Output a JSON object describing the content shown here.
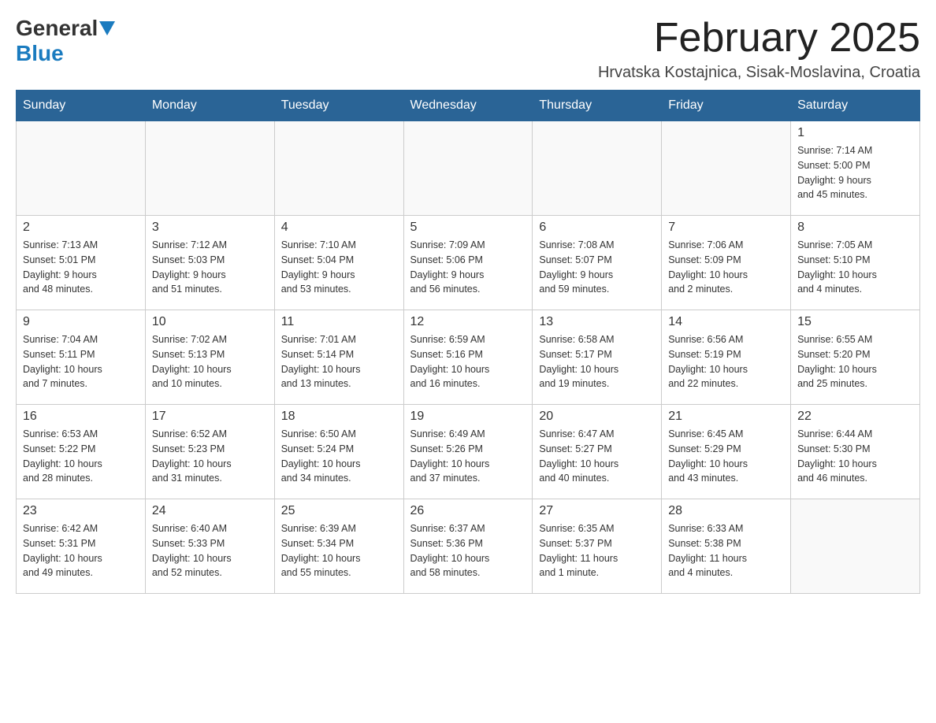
{
  "logo": {
    "general": "General",
    "blue": "Blue"
  },
  "title": "February 2025",
  "subtitle": "Hrvatska Kostajnica, Sisak-Moslavina, Croatia",
  "weekdays": [
    "Sunday",
    "Monday",
    "Tuesday",
    "Wednesday",
    "Thursday",
    "Friday",
    "Saturday"
  ],
  "weeks": [
    [
      {
        "day": "",
        "info": ""
      },
      {
        "day": "",
        "info": ""
      },
      {
        "day": "",
        "info": ""
      },
      {
        "day": "",
        "info": ""
      },
      {
        "day": "",
        "info": ""
      },
      {
        "day": "",
        "info": ""
      },
      {
        "day": "1",
        "info": "Sunrise: 7:14 AM\nSunset: 5:00 PM\nDaylight: 9 hours\nand 45 minutes."
      }
    ],
    [
      {
        "day": "2",
        "info": "Sunrise: 7:13 AM\nSunset: 5:01 PM\nDaylight: 9 hours\nand 48 minutes."
      },
      {
        "day": "3",
        "info": "Sunrise: 7:12 AM\nSunset: 5:03 PM\nDaylight: 9 hours\nand 51 minutes."
      },
      {
        "day": "4",
        "info": "Sunrise: 7:10 AM\nSunset: 5:04 PM\nDaylight: 9 hours\nand 53 minutes."
      },
      {
        "day": "5",
        "info": "Sunrise: 7:09 AM\nSunset: 5:06 PM\nDaylight: 9 hours\nand 56 minutes."
      },
      {
        "day": "6",
        "info": "Sunrise: 7:08 AM\nSunset: 5:07 PM\nDaylight: 9 hours\nand 59 minutes."
      },
      {
        "day": "7",
        "info": "Sunrise: 7:06 AM\nSunset: 5:09 PM\nDaylight: 10 hours\nand 2 minutes."
      },
      {
        "day": "8",
        "info": "Sunrise: 7:05 AM\nSunset: 5:10 PM\nDaylight: 10 hours\nand 4 minutes."
      }
    ],
    [
      {
        "day": "9",
        "info": "Sunrise: 7:04 AM\nSunset: 5:11 PM\nDaylight: 10 hours\nand 7 minutes."
      },
      {
        "day": "10",
        "info": "Sunrise: 7:02 AM\nSunset: 5:13 PM\nDaylight: 10 hours\nand 10 minutes."
      },
      {
        "day": "11",
        "info": "Sunrise: 7:01 AM\nSunset: 5:14 PM\nDaylight: 10 hours\nand 13 minutes."
      },
      {
        "day": "12",
        "info": "Sunrise: 6:59 AM\nSunset: 5:16 PM\nDaylight: 10 hours\nand 16 minutes."
      },
      {
        "day": "13",
        "info": "Sunrise: 6:58 AM\nSunset: 5:17 PM\nDaylight: 10 hours\nand 19 minutes."
      },
      {
        "day": "14",
        "info": "Sunrise: 6:56 AM\nSunset: 5:19 PM\nDaylight: 10 hours\nand 22 minutes."
      },
      {
        "day": "15",
        "info": "Sunrise: 6:55 AM\nSunset: 5:20 PM\nDaylight: 10 hours\nand 25 minutes."
      }
    ],
    [
      {
        "day": "16",
        "info": "Sunrise: 6:53 AM\nSunset: 5:22 PM\nDaylight: 10 hours\nand 28 minutes."
      },
      {
        "day": "17",
        "info": "Sunrise: 6:52 AM\nSunset: 5:23 PM\nDaylight: 10 hours\nand 31 minutes."
      },
      {
        "day": "18",
        "info": "Sunrise: 6:50 AM\nSunset: 5:24 PM\nDaylight: 10 hours\nand 34 minutes."
      },
      {
        "day": "19",
        "info": "Sunrise: 6:49 AM\nSunset: 5:26 PM\nDaylight: 10 hours\nand 37 minutes."
      },
      {
        "day": "20",
        "info": "Sunrise: 6:47 AM\nSunset: 5:27 PM\nDaylight: 10 hours\nand 40 minutes."
      },
      {
        "day": "21",
        "info": "Sunrise: 6:45 AM\nSunset: 5:29 PM\nDaylight: 10 hours\nand 43 minutes."
      },
      {
        "day": "22",
        "info": "Sunrise: 6:44 AM\nSunset: 5:30 PM\nDaylight: 10 hours\nand 46 minutes."
      }
    ],
    [
      {
        "day": "23",
        "info": "Sunrise: 6:42 AM\nSunset: 5:31 PM\nDaylight: 10 hours\nand 49 minutes."
      },
      {
        "day": "24",
        "info": "Sunrise: 6:40 AM\nSunset: 5:33 PM\nDaylight: 10 hours\nand 52 minutes."
      },
      {
        "day": "25",
        "info": "Sunrise: 6:39 AM\nSunset: 5:34 PM\nDaylight: 10 hours\nand 55 minutes."
      },
      {
        "day": "26",
        "info": "Sunrise: 6:37 AM\nSunset: 5:36 PM\nDaylight: 10 hours\nand 58 minutes."
      },
      {
        "day": "27",
        "info": "Sunrise: 6:35 AM\nSunset: 5:37 PM\nDaylight: 11 hours\nand 1 minute."
      },
      {
        "day": "28",
        "info": "Sunrise: 6:33 AM\nSunset: 5:38 PM\nDaylight: 11 hours\nand 4 minutes."
      },
      {
        "day": "",
        "info": ""
      }
    ]
  ]
}
